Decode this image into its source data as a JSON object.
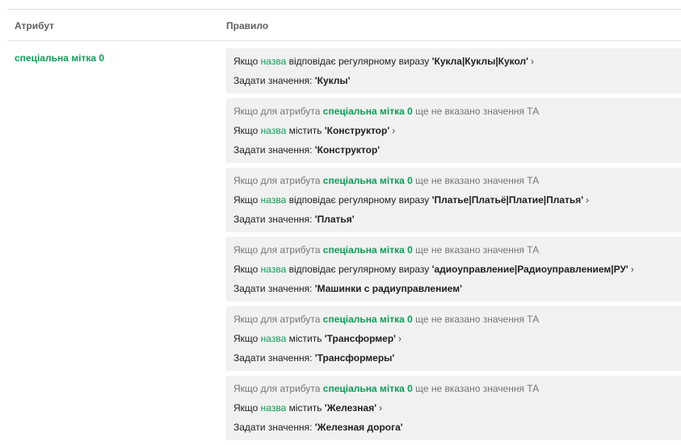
{
  "header": {
    "attribute": "Атрибут",
    "rule": "Правило"
  },
  "attribute_label": "спеціальна мітка 0",
  "labels": {
    "if": "Якщо",
    "name": "назва",
    "matches_regex": "відповідає регулярному виразу",
    "contains": "містить",
    "set_value": "Задати значення:",
    "if_for_attr": "Якщо для атрибута",
    "not_set_and": "ще не вказано значення ТА",
    "arrow": "›"
  },
  "rules": [
    {
      "id": "r0",
      "condition": "regex",
      "pattern": "'Кукла|Куклы|Кукол'",
      "value": "'Куклы'"
    },
    {
      "id": "r1",
      "condition": "contains",
      "pattern": "'Конструктор'",
      "value": "'Конструктор'"
    },
    {
      "id": "r2",
      "condition": "regex",
      "pattern": "'Платье|Платьё|Платие|Платья'",
      "value": "'Платья'"
    },
    {
      "id": "r3",
      "condition": "regex",
      "pattern": "'адиоуправление|Радиоуправлением|РУ'",
      "value": "'Машинки с радиуправлением'"
    },
    {
      "id": "r4",
      "condition": "contains",
      "pattern": "'Трансформер'",
      "value": "'Трансформеры'"
    },
    {
      "id": "r5",
      "condition": "contains",
      "pattern": "'Железная'",
      "value": "'Железная дорога'"
    }
  ]
}
